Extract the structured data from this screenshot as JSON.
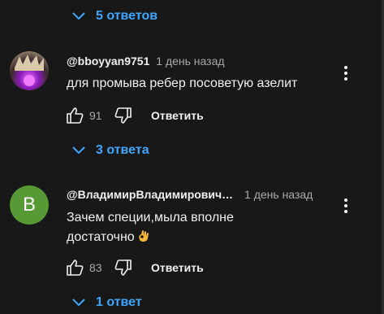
{
  "threads": [
    {
      "replies_label": "5 ответов"
    },
    {
      "author": "@bboyyan9751",
      "time": "1 день назад",
      "text": "для промыва ребер посоветую азелит",
      "likes": "91",
      "reply_label": "Ответить",
      "replies_label": "3 ответа",
      "avatar_icon": "anime-character-avatar"
    },
    {
      "author": "@ВладимирВладимирович…",
      "time": "1 день назад",
      "text_line1": "Зачем специи,мыла вполне",
      "text_line2": "достаточно",
      "emoji_icon": "ok-hand-emoji",
      "likes": "83",
      "reply_label": "Ответить",
      "replies_label": "1 ответ",
      "avatar_letter": "В"
    }
  ],
  "colors": {
    "background": "#181818",
    "link": "#3ea6ff",
    "avatar_green": "#579a35",
    "muted": "#aaaaaa"
  }
}
